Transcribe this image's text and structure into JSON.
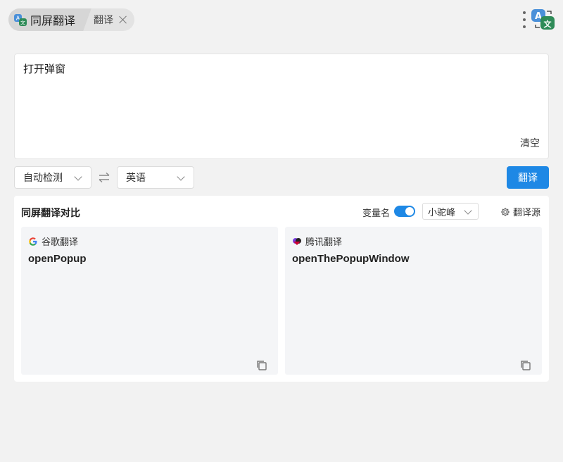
{
  "header": {
    "tab_main_label": "同屏翻译",
    "tab_sub_label": "翻译",
    "main_icon": "translate-app-icon",
    "close_icon": "close-icon",
    "more_icon": "more-vertical-icon",
    "logo_icon": "translate-logo-icon"
  },
  "input": {
    "text": "打开弹窗",
    "clear_label": "清空"
  },
  "controls": {
    "source_lang": "自动检测",
    "target_lang": "英语",
    "swap_icon": "swap-icon",
    "translate_label": "翻译"
  },
  "compare": {
    "title": "同屏翻译对比",
    "var_name_label": "变量名",
    "var_name_enabled": true,
    "case_style": "小驼峰",
    "source_label": "翻译源",
    "cards": [
      {
        "engine": "谷歌翻译",
        "icon": "google-icon",
        "result": "openPopup"
      },
      {
        "engine": "腾讯翻译",
        "icon": "tencent-icon",
        "result": "openThePopupWindow"
      }
    ]
  },
  "colors": {
    "accent": "#1e88e5",
    "background": "#f2f2f2",
    "card_bg": "#f4f5f7"
  }
}
